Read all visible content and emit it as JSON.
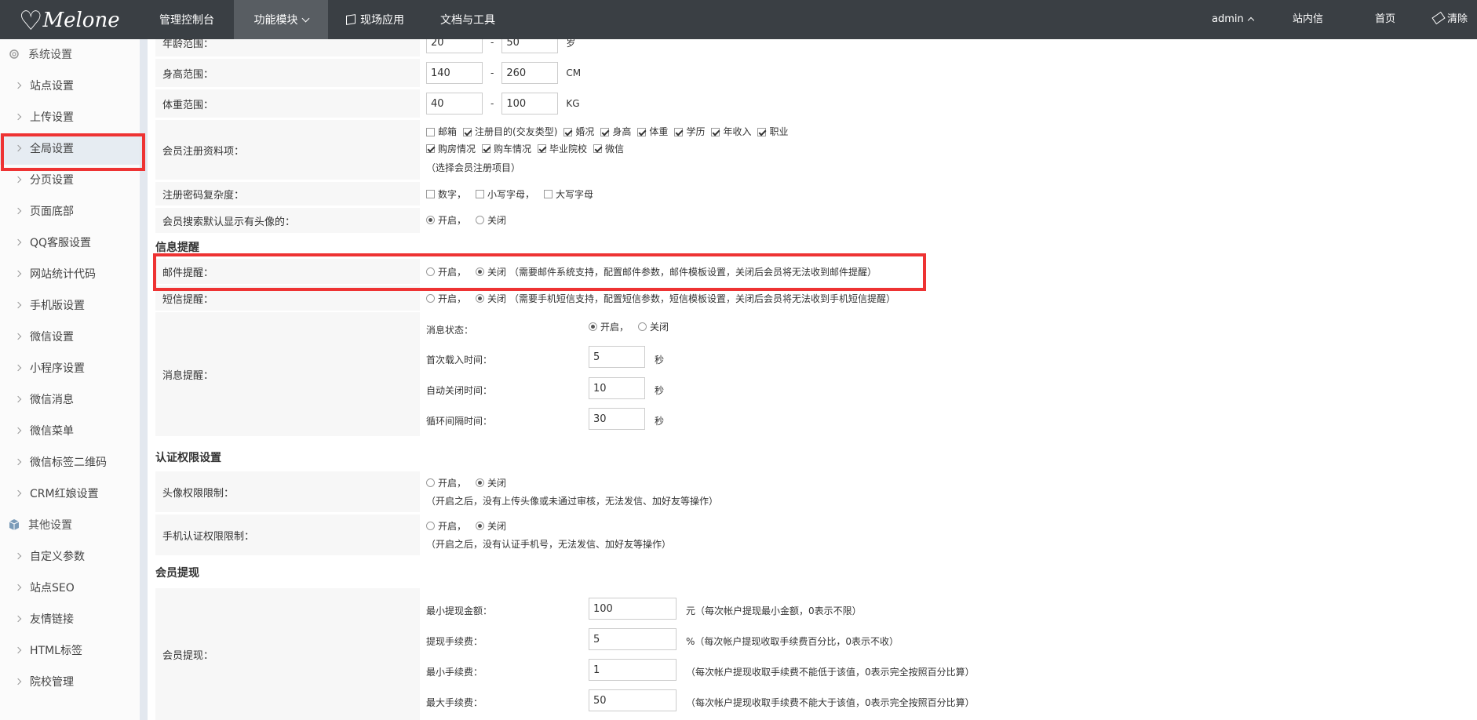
{
  "brand": {
    "logo": "Melone"
  },
  "nav": {
    "console": "管理控制台",
    "modules": "功能模块",
    "live": "现场应用",
    "docs": "文档与工具"
  },
  "rightnav": {
    "user": "admin",
    "message": "站内信",
    "home": "首页",
    "clear": "清除缓"
  },
  "sidebar": {
    "group1": "系统设置",
    "items1": [
      "站点设置",
      "上传设置",
      "全局设置",
      "分页设置",
      "页面底部",
      "QQ客服设置",
      "网站统计代码",
      "手机版设置",
      "微信设置",
      "小程序设置",
      "微信消息",
      "微信菜单",
      "微信标签二维码",
      "CRM红娘设置"
    ],
    "group2": "其他设置",
    "items2": [
      "自定义参数",
      "站点SEO",
      "友情链接",
      "HTML标签",
      "院校管理"
    ]
  },
  "form": {
    "age": {
      "label": "年龄范围：",
      "min": "20",
      "max": "50",
      "unit": "岁",
      "sep": "-"
    },
    "height": {
      "label": "身高范围：",
      "min": "140",
      "max": "260",
      "unit": "CM",
      "sep": "-"
    },
    "weight": {
      "label": "体重范围：",
      "min": "40",
      "max": "100",
      "unit": "KG",
      "sep": "-"
    },
    "regfields": {
      "label": "会员注册资料项：",
      "options": [
        {
          "text": "邮箱",
          "checked": false
        },
        {
          "text": "注册目的(交友类型)",
          "checked": true
        },
        {
          "text": "婚况",
          "checked": true
        },
        {
          "text": "身高",
          "checked": true
        },
        {
          "text": "体重",
          "checked": true
        },
        {
          "text": "学历",
          "checked": true
        },
        {
          "text": "年收入",
          "checked": true
        },
        {
          "text": "职业",
          "checked": true
        },
        {
          "text": "购房情况",
          "checked": true
        },
        {
          "text": "购车情况",
          "checked": true
        },
        {
          "text": "毕业院校",
          "checked": true
        },
        {
          "text": "微信",
          "checked": true
        }
      ],
      "hint": "（选择会员注册项目）"
    },
    "pwd": {
      "label": "注册密码复杂度：",
      "opt1": "数字，",
      "opt2": "小写字母，",
      "opt3": "大写字母"
    },
    "avatar_search": {
      "label": "会员搜索默认显示有头像的：",
      "on": "开启，",
      "off": "关闭"
    },
    "sec_notify": "信息提醒",
    "mail": {
      "label": "邮件提醒：",
      "on": "开启，",
      "off": "关闭",
      "note": "（需要邮件系统支持，配置邮件参数，邮件模板设置，关闭后会员将无法收到邮件提醒）"
    },
    "sms": {
      "label": "短信提醒：",
      "on": "开启，",
      "off": "关闭",
      "note": "（需要手机短信支持，配置短信参数，短信模板设置，关闭后会员将无法收到手机短信提醒）"
    },
    "msg": {
      "label": "消息提醒：",
      "status_label": "消息状态：",
      "on": "开启，",
      "off": "关闭",
      "first_label": "首次载入时间：",
      "first_val": "5",
      "auto_label": "自动关闭时间：",
      "auto_val": "10",
      "loop_label": "循环间隔时间：",
      "loop_val": "30",
      "sec": "秒"
    },
    "sec_auth": "认证权限设置",
    "avatar_limit": {
      "label": "头像权限限制：",
      "on": "开启，",
      "off": "关闭",
      "note": "（开启之后，没有上传头像或未通过审核，无法发信、加好友等操作）"
    },
    "phone_limit": {
      "label": "手机认证权限限制：",
      "on": "开启，",
      "off": "关闭",
      "note": "（开启之后，没有认证手机号，无法发信、加好友等操作）"
    },
    "sec_withdraw": "会员提现",
    "withdraw": {
      "label": "会员提现：",
      "min_label": "最小提现金额：",
      "min_val": "100",
      "min_note": "元（每次帐户提现最小金额，0表示不限）",
      "fee_label": "提现手续费：",
      "fee_val": "5",
      "fee_note": "%（每次帐户提现收取手续费百分比，0表示不收）",
      "minfee_label": "最小手续费：",
      "minfee_val": "1",
      "minfee_note": "（每次帐户提现收取手续费不能低于该值，0表示完全按照百分比算）",
      "maxfee_label": "最大手续费：",
      "maxfee_val": "50",
      "maxfee_note": "（每次帐户提现收取手续费不能大于该值，0表示完全按照百分比算）"
    }
  }
}
